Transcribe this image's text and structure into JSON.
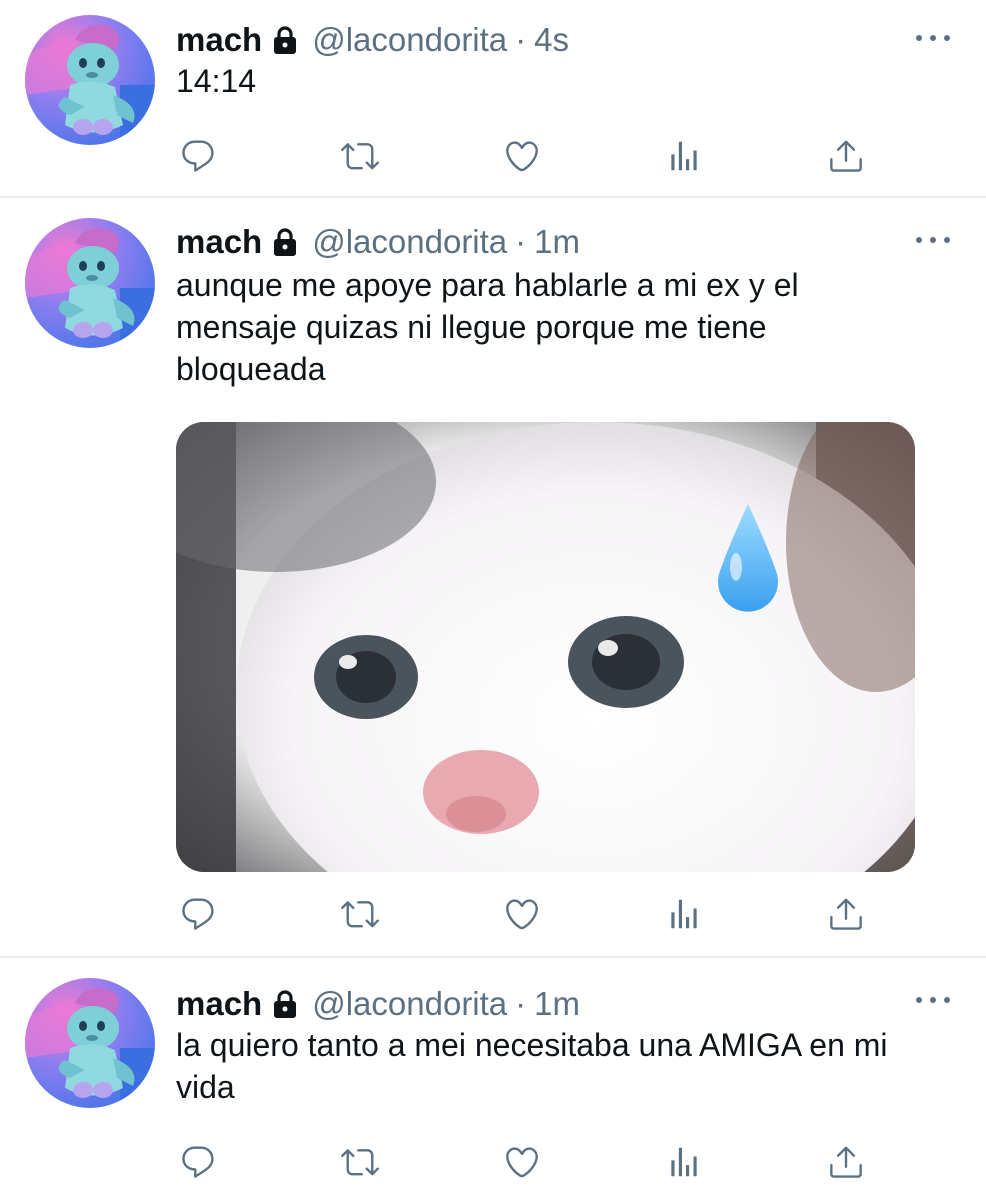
{
  "tweets": [
    {
      "name": "mach",
      "handle": "@lacondorita",
      "separator": "·",
      "time": "4s",
      "text": "14:14"
    },
    {
      "name": "mach",
      "handle": "@lacondorita",
      "separator": "·",
      "time": "1m",
      "text": "aunque me apoye para hablarle a mi ex y el mensaje quizas ni llegue porque me tiene bloqueada"
    },
    {
      "name": "mach",
      "handle": "@lacondorita",
      "separator": "·",
      "time": "1m",
      "text": "la quiero tanto a mei necesitaba una AMIGA en mi vida"
    }
  ],
  "colors": {
    "text_primary": "#0f1419",
    "text_secondary": "#5b7083",
    "icon": "#5b7083",
    "divider": "#e6ecf0"
  },
  "icons": [
    "lock-icon",
    "more-icon",
    "reply-icon",
    "retweet-icon",
    "like-icon",
    "analytics-icon",
    "share-icon",
    "sweat-drop-emoji"
  ]
}
